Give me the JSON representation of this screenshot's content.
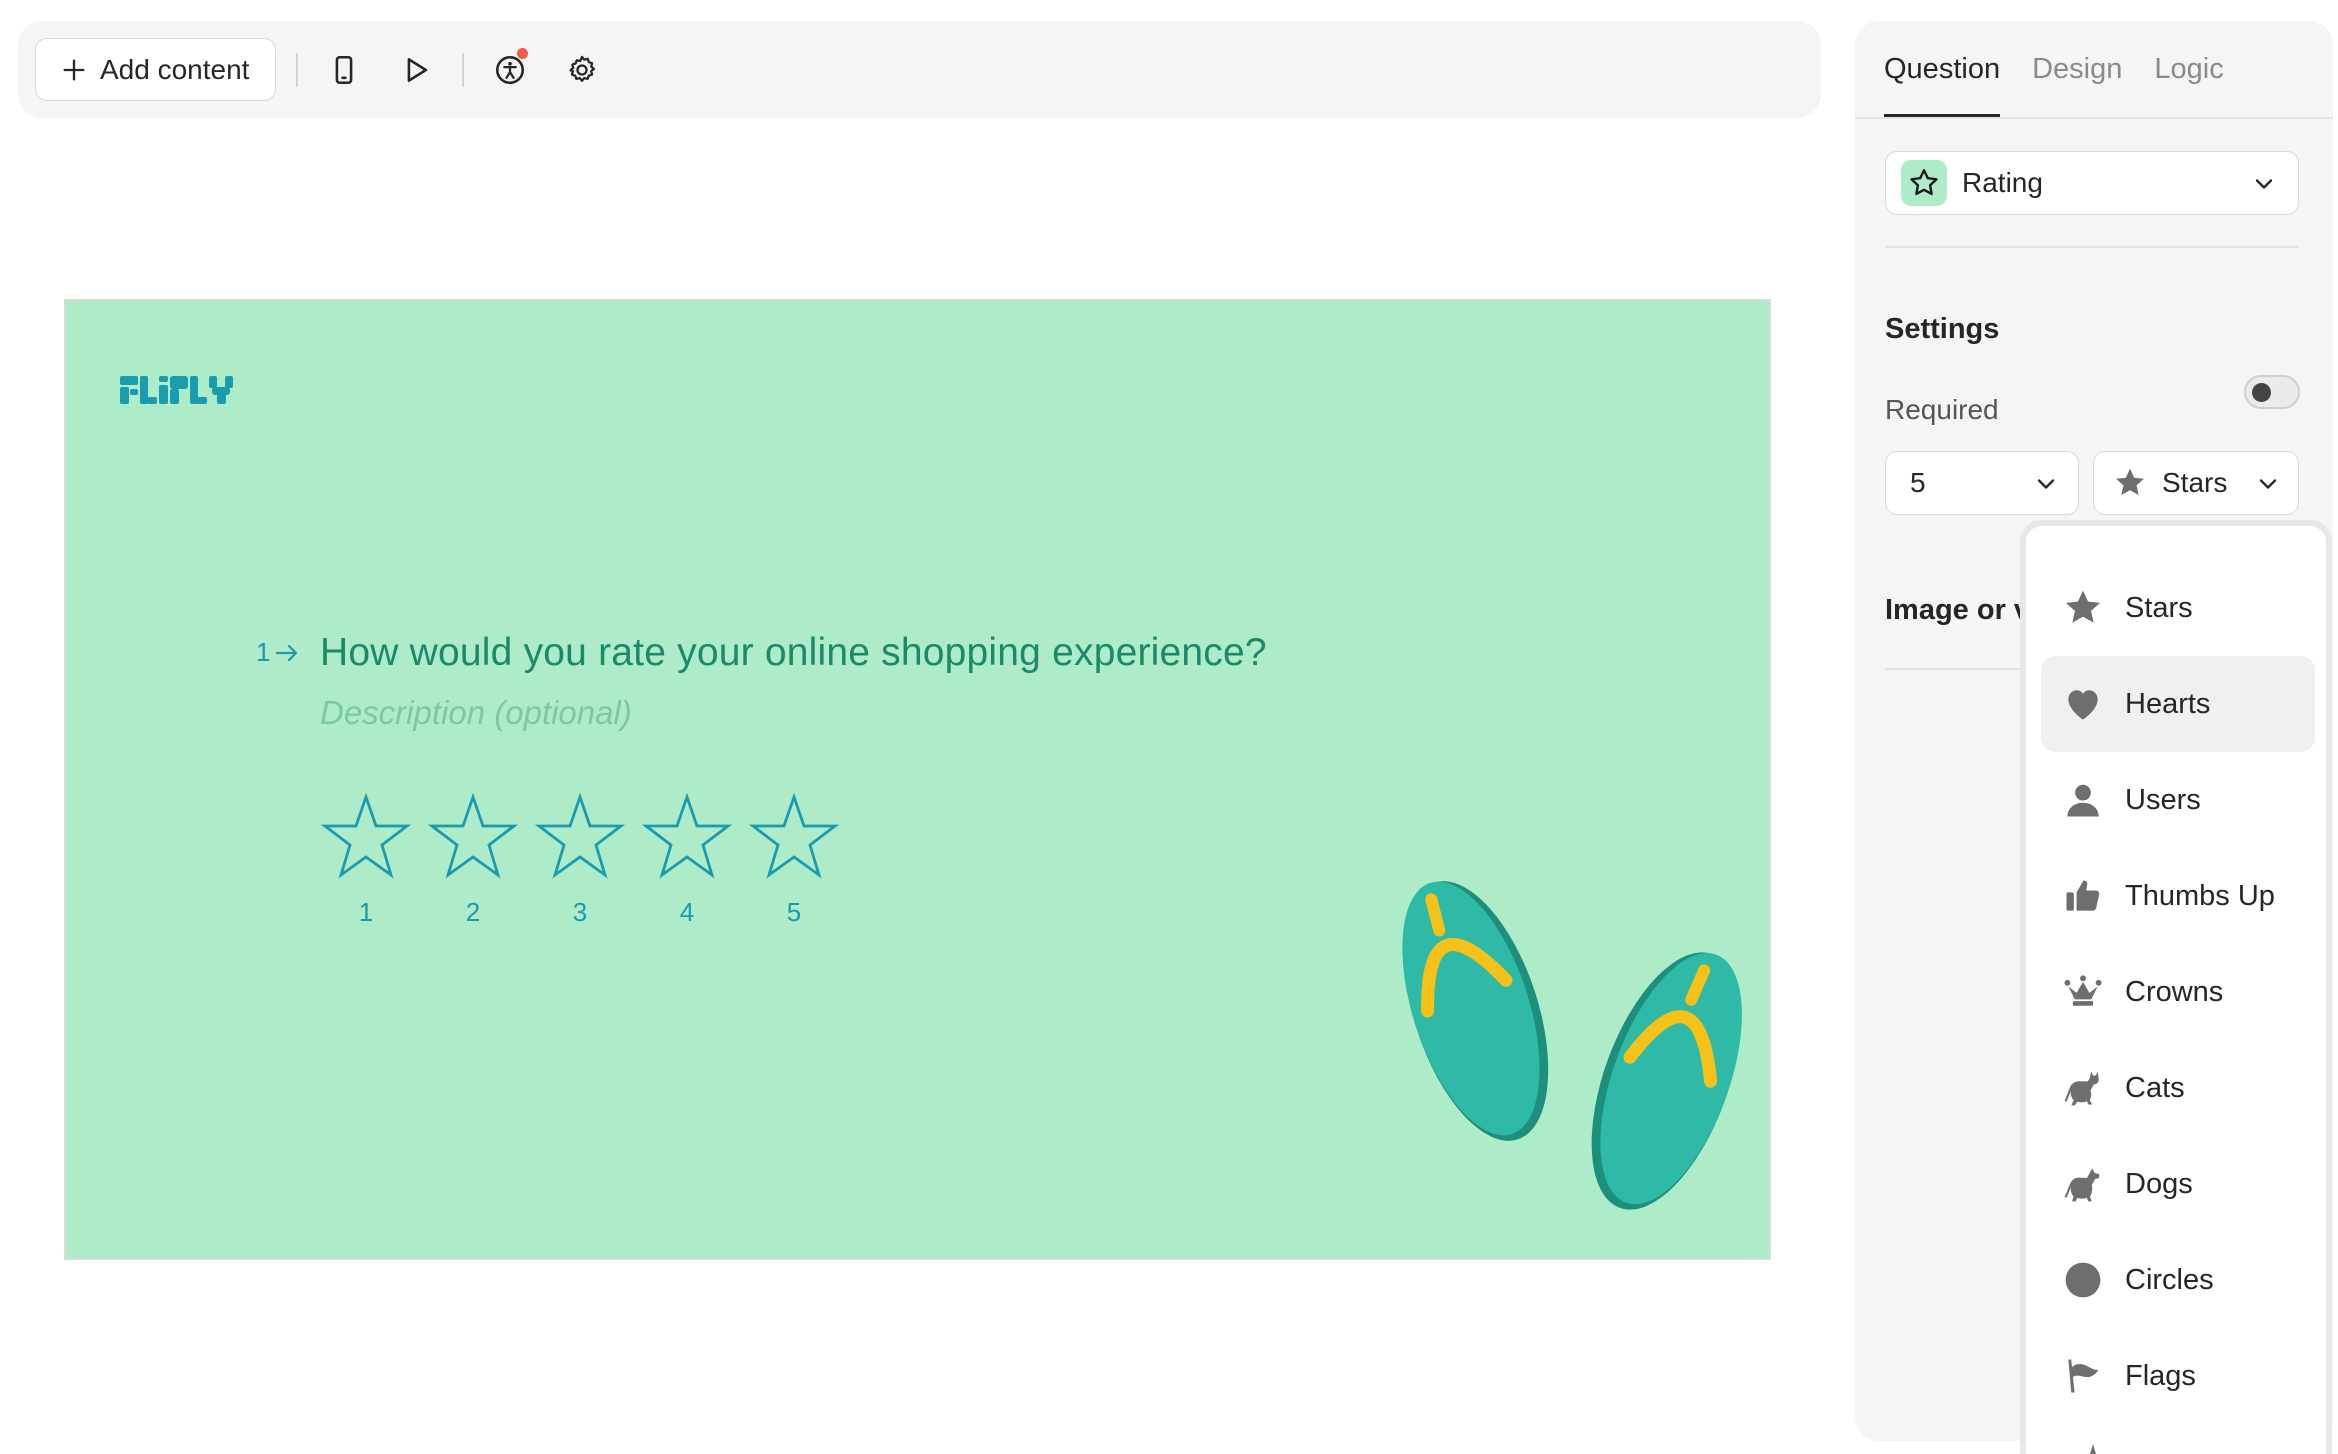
{
  "toolbar": {
    "add_content_label": "Add content",
    "icons": [
      "plus-icon",
      "mobile-preview-icon",
      "play-icon",
      "accessibility-icon",
      "gear-icon"
    ]
  },
  "canvas": {
    "background_color": "#aeebc9",
    "brand_color": "#1a9bb0",
    "question_color": "#1a8a6a",
    "logo_text": "FLIPLY",
    "question_number": "1",
    "question_text": "How would you rate your online shopping experience?",
    "description_placeholder": "Description (optional)",
    "rating_labels": [
      "1",
      "2",
      "3",
      "4",
      "5"
    ]
  },
  "panel": {
    "tabs": [
      "Question",
      "Design",
      "Logic"
    ],
    "active_tab": "Question",
    "question_type": "Rating",
    "settings_title": "Settings",
    "required_label": "Required",
    "required_on": false,
    "rating_count": "5",
    "rating_shape": "Stars",
    "image_section_title": "Image or v"
  },
  "dropdown": {
    "items": [
      {
        "label": "Stars",
        "icon": "star-icon"
      },
      {
        "label": "Hearts",
        "icon": "heart-icon"
      },
      {
        "label": "Users",
        "icon": "user-icon"
      },
      {
        "label": "Thumbs Up",
        "icon": "thumbs-up-icon"
      },
      {
        "label": "Crowns",
        "icon": "crown-icon"
      },
      {
        "label": "Cats",
        "icon": "cat-icon"
      },
      {
        "label": "Dogs",
        "icon": "dog-icon"
      },
      {
        "label": "Circles",
        "icon": "circle-icon"
      },
      {
        "label": "Flags",
        "icon": "flag-icon"
      }
    ],
    "highlighted": "Hearts"
  }
}
